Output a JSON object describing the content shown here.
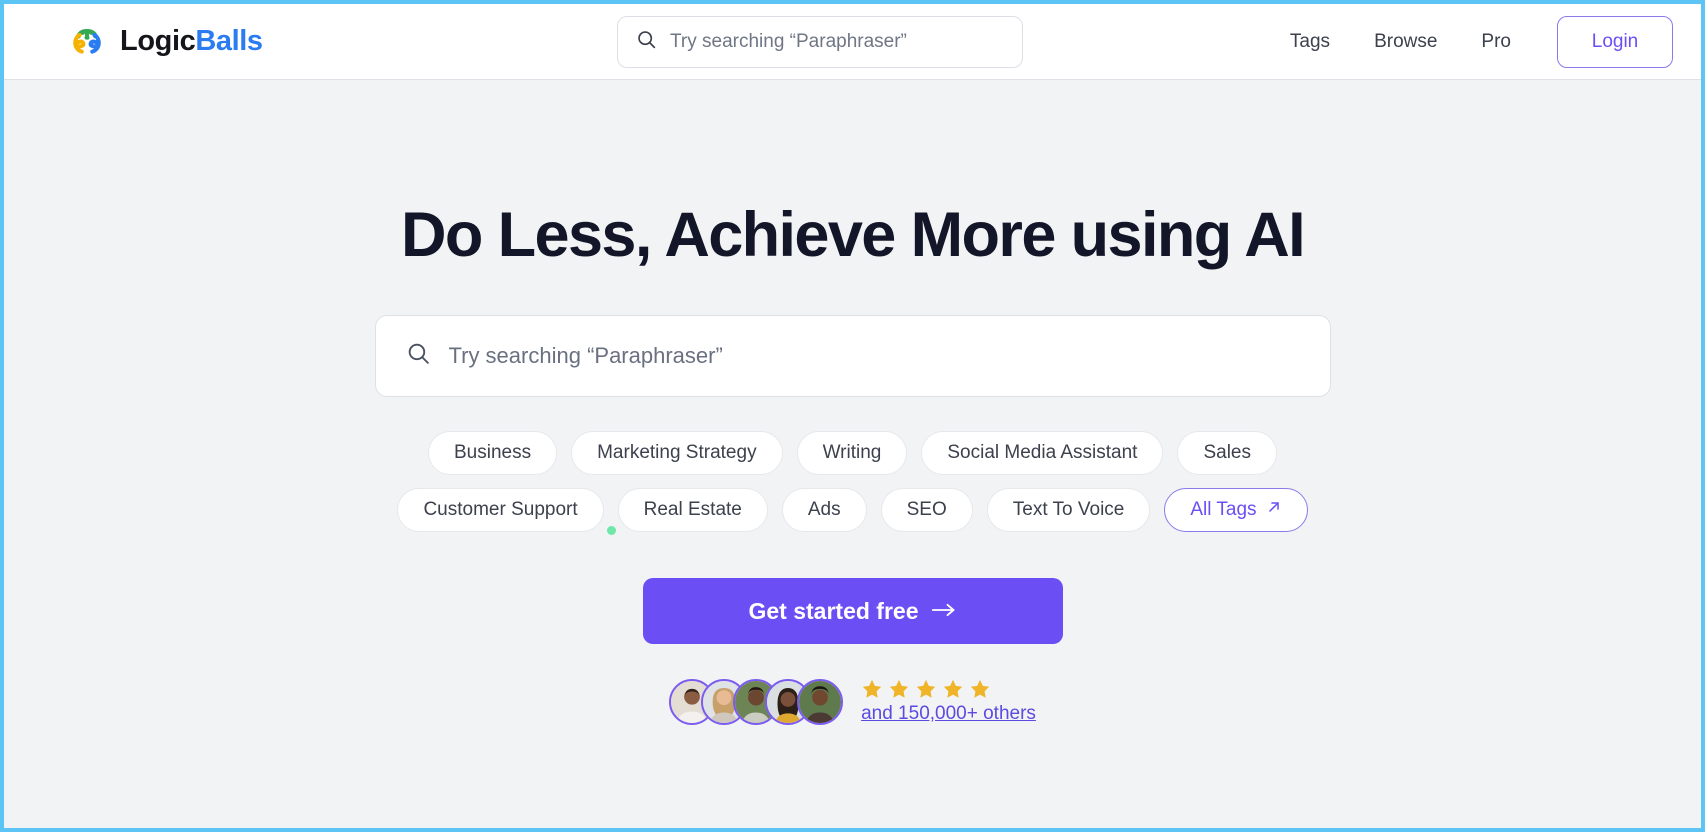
{
  "colors": {
    "accent": "#6c4ef5",
    "accent_soft": "#8b7bea",
    "brand_blue": "#2b7cf0",
    "brand_dark": "#15161c",
    "heading": "#131628",
    "page_bg": "#f2f3f5",
    "star_gold": "#f0b429",
    "dot_green": "#6ee7a8",
    "viewport_border": "#5cc5f5",
    "logo_green": "#34a853",
    "logo_yellow": "#f5b301",
    "logo_blue": "#2b7cf0"
  },
  "header": {
    "logo": {
      "icon": "logicballs-logo-icon",
      "text_primary": "Logic",
      "text_accent": "Balls"
    },
    "search": {
      "icon": "search-icon",
      "placeholder": "Try searching “Paraphraser”",
      "value": ""
    },
    "nav": [
      {
        "label": "Tags"
      },
      {
        "label": "Browse"
      },
      {
        "label": "Pro"
      }
    ],
    "login_label": "Login"
  },
  "hero": {
    "title": "Do Less, Achieve More using AI",
    "search": {
      "icon": "search-icon",
      "placeholder": "Try searching “Paraphraser”",
      "value": ""
    },
    "tags_row1": [
      {
        "label": "Business"
      },
      {
        "label": "Marketing Strategy"
      },
      {
        "label": "Writing"
      },
      {
        "label": "Social Media Assistant"
      },
      {
        "label": "Sales"
      }
    ],
    "tags_row2": [
      {
        "label": "Customer Support"
      },
      {
        "label": "Real Estate"
      },
      {
        "label": "Ads"
      },
      {
        "label": "SEO"
      },
      {
        "label": "Text To Voice"
      }
    ],
    "all_tags": {
      "label": "All Tags",
      "icon": "arrow-up-right-icon"
    },
    "cta": {
      "label": "Get started free",
      "icon": "arrow-right-icon"
    },
    "social_proof": {
      "avatar_count": 5,
      "avatars": [
        {
          "name": "avatar-1"
        },
        {
          "name": "avatar-2"
        },
        {
          "name": "avatar-3"
        },
        {
          "name": "avatar-4"
        },
        {
          "name": "avatar-5"
        }
      ],
      "star_count": 5,
      "star_icon": "star-filled-icon",
      "others_label": "and 150,000+ others"
    }
  }
}
